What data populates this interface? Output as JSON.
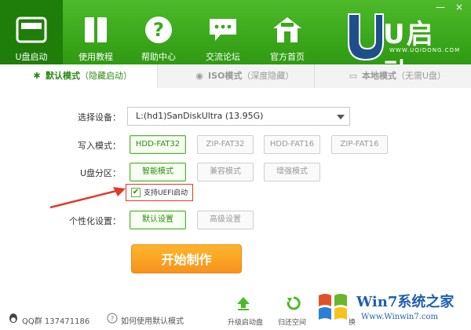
{
  "window": {
    "minimize_glyph": "—",
    "close_glyph": "×"
  },
  "nav": [
    {
      "label": "U盘启动",
      "icon": "usb-drive-icon",
      "active": true
    },
    {
      "label": "使用教程",
      "icon": "book-icon",
      "active": false
    },
    {
      "label": "帮助中心",
      "icon": "help-icon",
      "active": false
    },
    {
      "label": "交流论坛",
      "icon": "chat-bubble-icon",
      "active": false
    },
    {
      "label": "官方首页",
      "icon": "home-icon",
      "active": false
    }
  ],
  "logo": {
    "text": "U启动",
    "url": "WWW.UQIDONG.COM"
  },
  "tabs": [
    {
      "icon": "tools-icon",
      "label": "默认模式",
      "hint": "（隐藏启动）",
      "active": true
    },
    {
      "icon": "disc-icon",
      "label": "ISO模式",
      "hint": "（深度隐藏）",
      "active": false
    },
    {
      "icon": "monitor-icon",
      "label": "本地模式",
      "hint": "（无需U盘）",
      "active": false
    }
  ],
  "form": {
    "device_label": "选择设备：",
    "device_value": "L:(hd1)SanDiskUltra (13.95G)",
    "write_label": "写入模式：",
    "write_options": [
      "HDD-FAT32",
      "ZIP-FAT32",
      "HDD-FAT16",
      "ZIP-FAT16"
    ],
    "partition_label": "U盘分区：",
    "partition_options": [
      "智能模式",
      "兼容模式",
      "增强模式"
    ],
    "uefi_label": "支持UEFI启动",
    "uefi_checked": true,
    "personal_label": "个性化设置：",
    "personal_options": [
      "默认设置",
      "高级设置"
    ]
  },
  "start_button": "开始制作",
  "bottom": {
    "qq": "QQ群 137471186",
    "howto": "如何使用默认模式",
    "upgrade": "升级启动盘",
    "restore": "归还空间",
    "watermark_main": "Win7系统之家",
    "watermark_url": "Www.Winwin7.com",
    "partial_label": "换"
  },
  "colors": {
    "header": "#3aa91a",
    "accent": "#2d8a13",
    "start": "#f7931e",
    "arrow": "#e03a2a"
  }
}
